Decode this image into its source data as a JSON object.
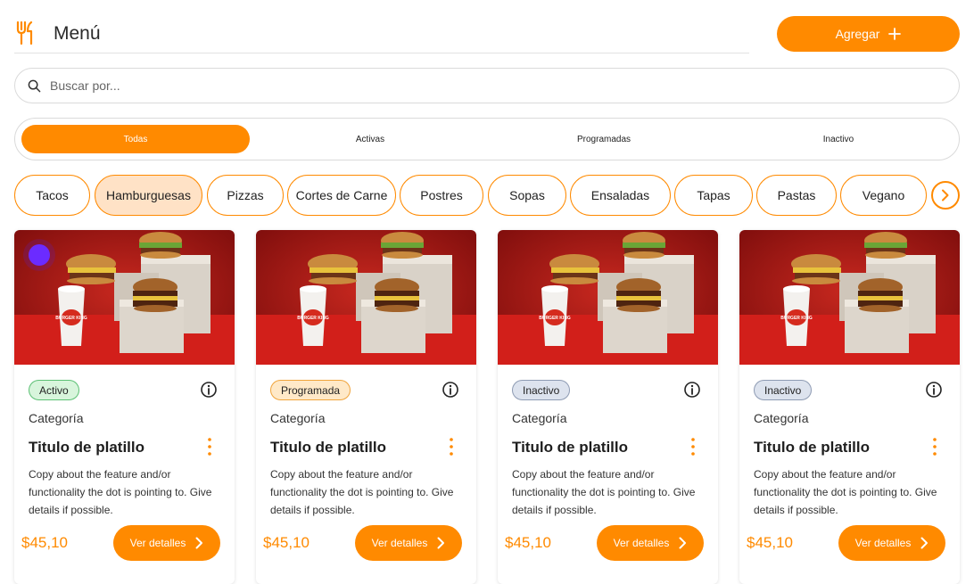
{
  "header": {
    "title": "Menú",
    "icon": "fork-knife-icon",
    "add_button_label": "Agregar"
  },
  "search": {
    "placeholder": "Buscar por...",
    "value": ""
  },
  "status_tabs": [
    {
      "label": "Todas",
      "active": true
    },
    {
      "label": "Activas",
      "active": false
    },
    {
      "label": "Programadas",
      "active": false
    },
    {
      "label": "Inactivo",
      "active": false
    }
  ],
  "categories": [
    {
      "label": "Tacos",
      "selected": false
    },
    {
      "label": "Hamburguesas",
      "selected": true
    },
    {
      "label": "Pizzas",
      "selected": false
    },
    {
      "label": "Cortes de Carne",
      "selected": false
    },
    {
      "label": "Postres",
      "selected": false
    },
    {
      "label": "Sopas",
      "selected": false
    },
    {
      "label": "Ensaladas",
      "selected": false
    },
    {
      "label": "Tapas",
      "selected": false
    },
    {
      "label": "Pastas",
      "selected": false
    },
    {
      "label": "Vegano",
      "selected": false
    }
  ],
  "cards": [
    {
      "status": "Activo",
      "status_kind": "activo",
      "category": "Categoría",
      "title": "Titulo de platillo",
      "description": "Copy about the feature and/or functionality the dot is pointing to. Give details if possible.",
      "price": "$45,10",
      "button_label": "Ver detalles",
      "image_cup_text": "BURGER KING",
      "has_indicator_dot": true
    },
    {
      "status": "Programada",
      "status_kind": "programada",
      "category": "Categoría",
      "title": "Titulo de platillo",
      "description": "Copy about the feature and/or functionality the dot is pointing to. Give details if possible.",
      "price": "$45,10",
      "button_label": "Ver detalles",
      "image_cup_text": "BURGER KING",
      "has_indicator_dot": false
    },
    {
      "status": "Inactivo",
      "status_kind": "inactivo",
      "category": "Categoría",
      "title": "Titulo de platillo",
      "description": "Copy about the feature and/or functionality the dot is pointing to. Give details if possible.",
      "price": "$45,10",
      "button_label": "Ver detalles",
      "image_cup_text": "BURGER KING",
      "has_indicator_dot": false
    },
    {
      "status": "Inactivo",
      "status_kind": "inactivo",
      "category": "Categoría",
      "title": "Titulo de platillo",
      "description": "Copy about the feature and/or functionality the dot is pointing to. Give details if possible.",
      "price": "$45,10",
      "button_label": "Ver detalles",
      "image_cup_text": "BURGER KING",
      "has_indicator_dot": false
    }
  ],
  "colors": {
    "accent": "#ff8a00",
    "selected_chip": "#ffe2c6",
    "indicator_dot": "#6b2bff"
  }
}
